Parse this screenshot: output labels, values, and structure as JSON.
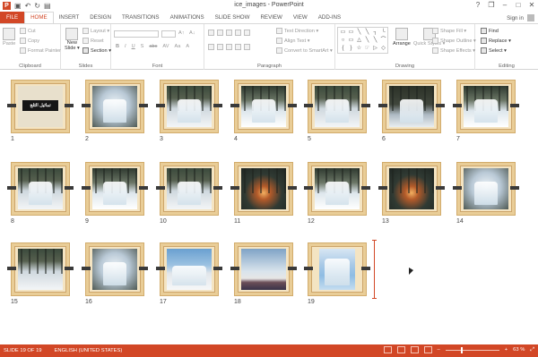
{
  "window": {
    "title": "ice_images - PowerPoint",
    "app_icon": "P",
    "quick_access": [
      "save-icon",
      "undo-icon",
      "redo-icon",
      "start-from-beginning-icon"
    ],
    "controls": [
      "?",
      "❐",
      "–",
      "□",
      "✕"
    ]
  },
  "tabs": [
    "FILE",
    "HOME",
    "INSERT",
    "DESIGN",
    "TRANSITIONS",
    "ANIMATIONS",
    "SLIDE SHOW",
    "REVIEW",
    "VIEW",
    "ADD-INS"
  ],
  "active_tab": "HOME",
  "signin": "Sign in",
  "ribbon": {
    "clipboard": {
      "label": "Clipboard",
      "paste": "Paste",
      "cut": "Cut",
      "copy": "Copy",
      "format_painter": "Format Painter"
    },
    "slides": {
      "label": "Slides",
      "new_slide_line1": "New",
      "new_slide_line2": "Slide ▾",
      "layout": "Layout ▾",
      "reset": "Reset",
      "section": "Section ▾"
    },
    "font": {
      "label": "Font",
      "format_buttons": [
        "B",
        "I",
        "U",
        "S",
        "abc",
        "AV",
        "Aa",
        "A"
      ]
    },
    "paragraph": {
      "label": "Paragraph",
      "text_direction": "Text Direction ▾",
      "align_text": "Align Text ▾",
      "convert_smartart": "Convert to SmartArt ▾"
    },
    "drawing": {
      "label": "Drawing",
      "arrange": "Arrange",
      "quick_styles": "Quick Styles ▾",
      "shape_fill": "Shape Fill ▾",
      "shape_outline": "Shape Outline ▾",
      "shape_effects": "Shape Effects ▾",
      "shapes": [
        "▭",
        "▭",
        "╲",
        "╲",
        "┐",
        "└",
        "○",
        "▭",
        "△",
        "╲",
        "╲",
        "⌒",
        "{",
        "}",
        "☆",
        "☞",
        "▷",
        "◇"
      ]
    },
    "editing": {
      "label": "Editing",
      "find": "Find",
      "replace": "Replace ▾",
      "select": "Select ▾"
    }
  },
  "slides": [
    {
      "num": "1",
      "title_text": "تماثيل الثلج"
    },
    {
      "num": "2"
    },
    {
      "num": "3"
    },
    {
      "num": "4"
    },
    {
      "num": "5"
    },
    {
      "num": "6"
    },
    {
      "num": "7"
    },
    {
      "num": "8"
    },
    {
      "num": "9"
    },
    {
      "num": "10"
    },
    {
      "num": "11"
    },
    {
      "num": "12"
    },
    {
      "num": "13"
    },
    {
      "num": "14"
    },
    {
      "num": "15"
    },
    {
      "num": "16"
    },
    {
      "num": "17"
    },
    {
      "num": "18"
    },
    {
      "num": "19"
    }
  ],
  "status": {
    "slide_info": "SLIDE 19 OF 19",
    "language": "ENGLISH (UNITED STATES)",
    "zoom": "63 %",
    "zoom_minus": "–",
    "zoom_plus": "+"
  }
}
